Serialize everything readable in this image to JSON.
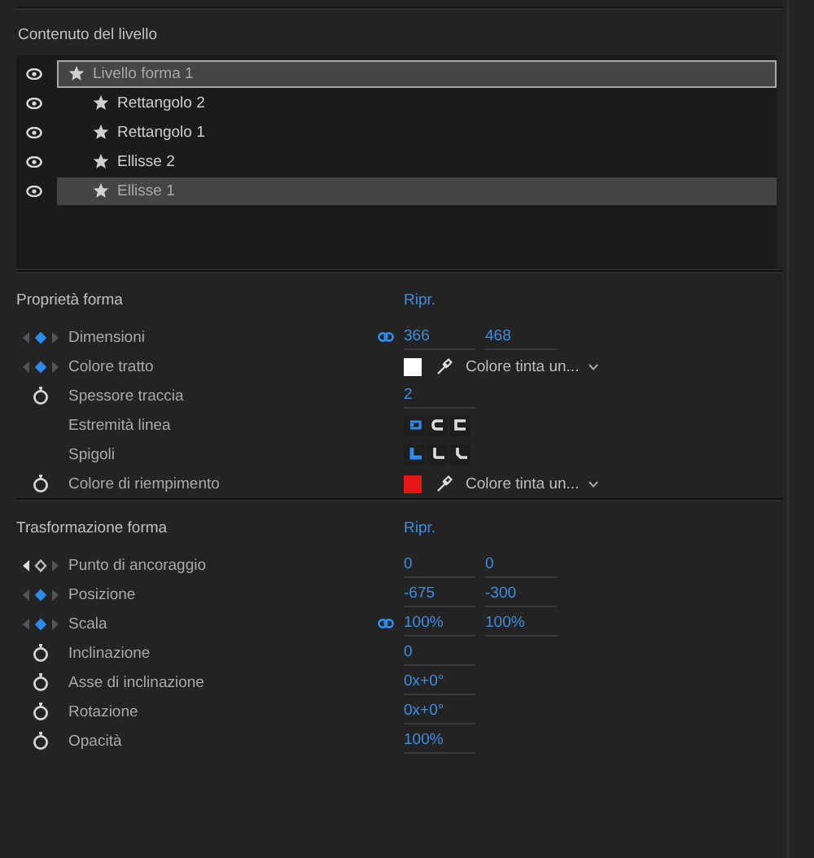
{
  "layer_contents": {
    "title": "Contenuto del livello",
    "tree": [
      {
        "label": "Livello forma 1",
        "selected": true,
        "focused": true,
        "visible": true,
        "children": [
          {
            "label": "Rettangolo 2",
            "selected": false,
            "focused": false,
            "visible": true
          },
          {
            "label": "Rettangolo 1",
            "selected": false,
            "focused": false,
            "visible": true
          },
          {
            "label": "Ellisse 2",
            "selected": false,
            "focused": false,
            "visible": true
          },
          {
            "label": "Ellisse 1",
            "selected": true,
            "focused": false,
            "visible": true
          }
        ]
      }
    ]
  },
  "sections": [
    {
      "title": "Proprietà forma",
      "reset": "Ripr.",
      "rows": [
        {
          "label": "Dimensioni",
          "control": {
            "kind": "keyframes",
            "keyframe": true
          },
          "kind": "numbers",
          "linked": true,
          "values": [
            "366",
            "468"
          ]
        },
        {
          "label": "Colore tratto",
          "control": {
            "kind": "keyframes",
            "keyframe": true
          },
          "kind": "color",
          "color": "#ffffff",
          "dropdown": "Colore tinta un..."
        },
        {
          "label": "Spessore traccia",
          "control": {
            "kind": "stopwatch"
          },
          "kind": "numbers",
          "values": [
            "2"
          ]
        },
        {
          "label": "Estremità linea",
          "kind": "caps",
          "options": [
            {
              "selected": true
            },
            {
              "selected": false
            },
            {
              "selected": false
            }
          ]
        },
        {
          "label": "Spigoli",
          "kind": "joins",
          "options": [
            {
              "selected": true
            },
            {
              "selected": false
            },
            {
              "selected": false
            }
          ]
        },
        {
          "label": "Colore di riempimento",
          "control": {
            "kind": "stopwatch"
          },
          "kind": "color",
          "color": "#e8141a",
          "dropdown": "Colore tinta un..."
        }
      ]
    },
    {
      "title": "Trasformazione forma",
      "reset": "Ripr.",
      "rows": [
        {
          "label": "Punto di ancoraggio",
          "control": {
            "kind": "keyframes",
            "keyframe": false
          },
          "kind": "numbers",
          "values": [
            "0",
            "0"
          ]
        },
        {
          "label": "Posizione",
          "control": {
            "kind": "keyframes",
            "keyframe": true
          },
          "kind": "numbers",
          "values": [
            "-675",
            "-300"
          ]
        },
        {
          "label": "Scala",
          "control": {
            "kind": "keyframes",
            "keyframe": true
          },
          "kind": "numbers",
          "linked": true,
          "values": [
            "100%",
            "100%"
          ]
        },
        {
          "label": "Inclinazione",
          "control": {
            "kind": "stopwatch"
          },
          "kind": "numbers",
          "values": [
            "0"
          ]
        },
        {
          "label": "Asse di inclinazione",
          "control": {
            "kind": "stopwatch"
          },
          "kind": "numbers",
          "values": [
            "0x+0°"
          ]
        },
        {
          "label": "Rotazione",
          "control": {
            "kind": "stopwatch"
          },
          "kind": "numbers",
          "values": [
            "0x+0°"
          ]
        },
        {
          "label": "Opacità",
          "control": {
            "kind": "stopwatch"
          },
          "kind": "numbers",
          "values": [
            "100%"
          ]
        }
      ]
    }
  ]
}
